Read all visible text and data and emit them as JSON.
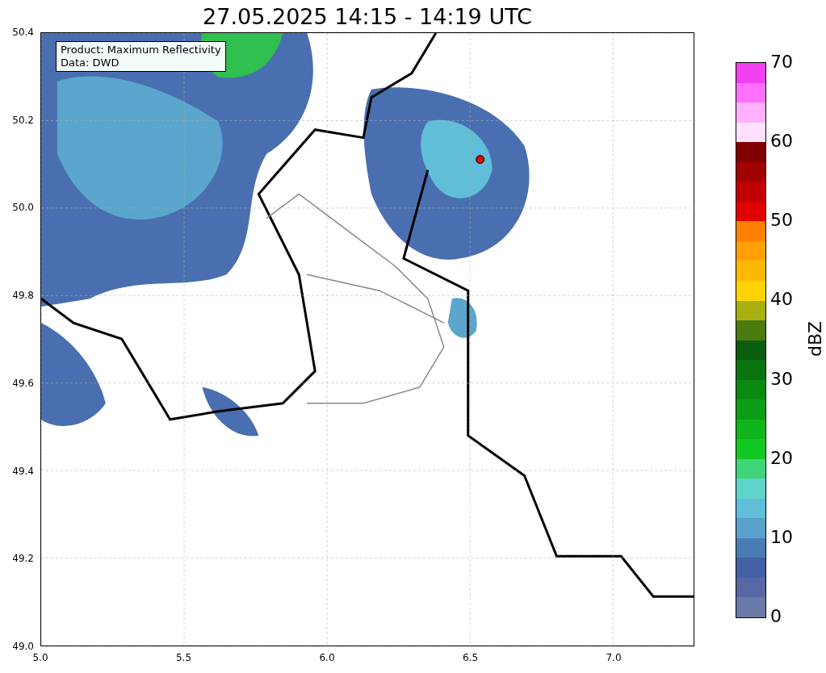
{
  "title": "27.05.2025 14:15 - 14:19 UTC",
  "map": {
    "y_ticks": [
      "50.4",
      "50.2",
      "50.0",
      "49.8",
      "49.6",
      "49.4",
      "49.2",
      "49.0"
    ],
    "x_ticks": [
      "5.0",
      "5.5",
      "6.0",
      "6.5",
      "7.0"
    ],
    "legend_lines": [
      "Product: Maximum Reflectivity",
      "Data: DWD"
    ]
  },
  "colorbar": {
    "label": "dBZ",
    "ticks": [
      "70",
      "60",
      "50",
      "40",
      "30",
      "20",
      "10",
      "0"
    ],
    "segments": [
      {
        "color": "#6a7aa8"
      },
      {
        "color": "#5868a4"
      },
      {
        "color": "#4460a4"
      },
      {
        "color": "#4a7cb4"
      },
      {
        "color": "#5aa0cc"
      },
      {
        "color": "#60bed8"
      },
      {
        "color": "#60d4c8"
      },
      {
        "color": "#40d47a"
      },
      {
        "color": "#10c820"
      },
      {
        "color": "#10b41c"
      },
      {
        "color": "#0c9e16"
      },
      {
        "color": "#0a8a12"
      },
      {
        "color": "#0a7410"
      },
      {
        "color": "#085e0c"
      },
      {
        "color": "#4a7a10"
      },
      {
        "color": "#a8b010"
      },
      {
        "color": "#ffd400"
      },
      {
        "color": "#ffb800"
      },
      {
        "color": "#ffa000"
      },
      {
        "color": "#ff8000"
      },
      {
        "color": "#e00000"
      },
      {
        "color": "#c00000"
      },
      {
        "color": "#a00000"
      },
      {
        "color": "#800000"
      },
      {
        "color": "#ffe0ff"
      },
      {
        "color": "#ffb0ff"
      },
      {
        "color": "#ff70ff"
      },
      {
        "color": "#f040f0"
      }
    ]
  }
}
